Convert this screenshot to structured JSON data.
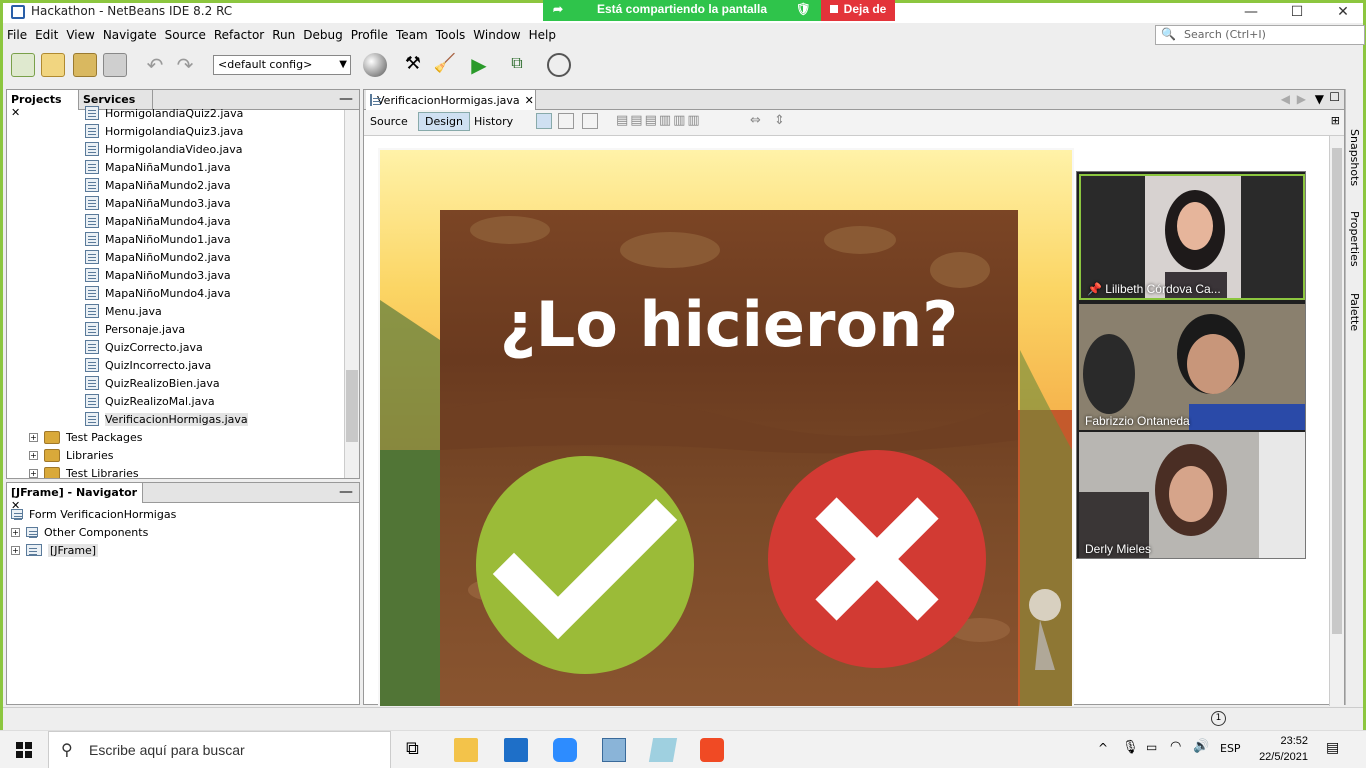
{
  "window": {
    "title": "Hackathon - NetBeans IDE 8.2 RC",
    "minimize": "—",
    "maximize": "☐",
    "close": "✕"
  },
  "share_banner": {
    "text": "Está compartiendo la pantalla",
    "stop_label": "Deja de"
  },
  "menubar": {
    "items": [
      "File",
      "Edit",
      "View",
      "Navigate",
      "Source",
      "Refactor",
      "Run",
      "Debug",
      "Profile",
      "Team",
      "Tools",
      "Window",
      "Help"
    ]
  },
  "search": {
    "placeholder": "Search (Ctrl+I)"
  },
  "toolbar": {
    "config": "<default config>"
  },
  "projects_panel": {
    "tab_projects": "Projects",
    "tab_services": "Services",
    "files": [
      "HormigolandiaQuiz2.java",
      "HormigolandiaQuiz3.java",
      "HormigolandiaVideo.java",
      "MapaNiñaMundo1.java",
      "MapaNiñaMundo2.java",
      "MapaNiñaMundo3.java",
      "MapaNiñaMundo4.java",
      "MapaNiñoMundo1.java",
      "MapaNiñoMundo2.java",
      "MapaNiñoMundo3.java",
      "MapaNiñoMundo4.java",
      "Menu.java",
      "Personaje.java",
      "QuizCorrecto.java",
      "QuizIncorrecto.java",
      "QuizRealizoBien.java",
      "QuizRealizoMal.java",
      "VerificacionHormigas.java"
    ],
    "folders": [
      "Test Packages",
      "Libraries",
      "Test Libraries"
    ]
  },
  "navigator": {
    "title": "[JFrame] - Navigator",
    "items": [
      "Form VerificacionHormigas",
      "Other Components",
      "[JFrame]"
    ]
  },
  "editor": {
    "tab": "VerificacionHormigas.java",
    "modes": [
      "Source",
      "Design",
      "History"
    ]
  },
  "game": {
    "question": "¿Lo hicieron?"
  },
  "zoom": {
    "participants": [
      "Lilibeth Córdova Ca...",
      "Fabrizzio Ontaneda",
      "Derly Mieles"
    ]
  },
  "side_tabs": [
    "Snapshots",
    "Properties",
    "Palette"
  ],
  "status": {
    "notifications": "1"
  },
  "taskbar": {
    "search_placeholder": "Escribe aquí para buscar",
    "lang": "ESP",
    "time": "23:52",
    "date": "22/5/2021"
  },
  "colors": {
    "share_green": "#2fc44b",
    "share_red": "#e3343a",
    "yes": "#9bbb38",
    "no": "#d23a33"
  }
}
